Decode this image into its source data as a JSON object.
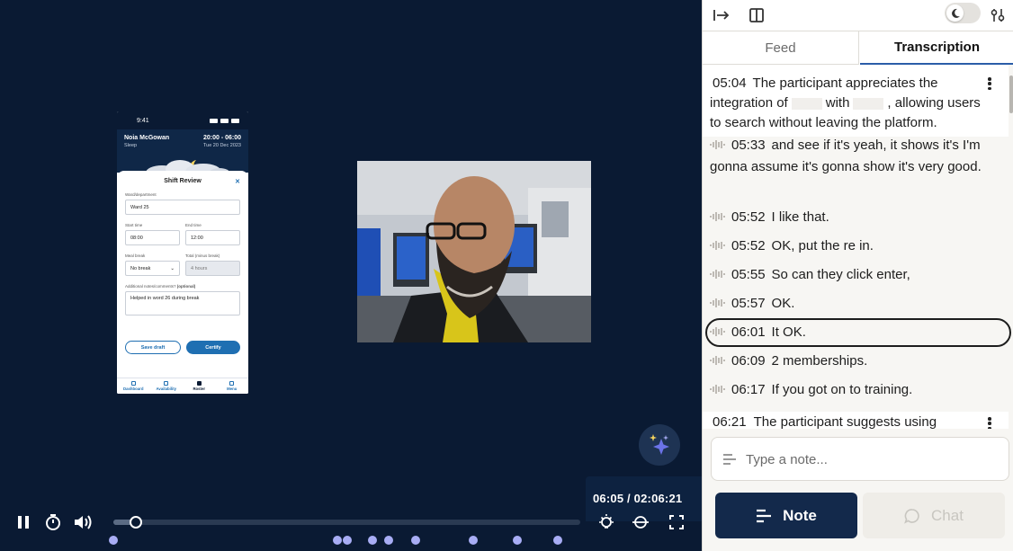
{
  "phone": {
    "status_time": "9:41",
    "user_name": "Noia McGowan",
    "shift_time": "20:00 - 06:00",
    "shift_type": "Sleep",
    "shift_date": "Tue 20 Dec 2023",
    "sheet_title": "Shift Review",
    "ward_label": "Ward/department",
    "ward_value": "Ward 25",
    "start_label": "Start time",
    "start_value": "08:00",
    "end_label": "End time",
    "end_value": "12:00",
    "meal_label": "Meal break",
    "meal_value": "No break",
    "total_label": "Total (minus break)",
    "total_value": "4 hours",
    "notes_label": "Additional notes/comments?",
    "notes_optional": "(optional)",
    "notes_value": "Helped in word 26 during break",
    "save_draft": "Save draft",
    "certify": "Certify",
    "tabs": [
      "Dashboard",
      "Availability",
      "Roster",
      "Menu"
    ]
  },
  "player": {
    "time_display": "06:05 / 02:06:21",
    "progress": 0.048,
    "marker_fractions": [
      0.0,
      0.48,
      0.5,
      0.555,
      0.59,
      0.647,
      0.77,
      0.865,
      0.952
    ]
  },
  "panel": {
    "tabs": {
      "feed": "Feed",
      "transcription": "Transcription"
    },
    "summary": {
      "time": "05:04",
      "text_before": "The participant appreciates the integration of",
      "text_mid": "with",
      "text_after": ", allowing users to search without leaving the platform."
    },
    "utterances": [
      {
        "time": "05:33",
        "text": "and see if it's yeah, it shows it's I'm gonna assume it's gonna show it's very good."
      },
      {
        "time": "05:52",
        "text": "I like that."
      },
      {
        "time": "05:52",
        "text": "OK, put the re in."
      },
      {
        "time": "05:55",
        "text": "So can they click enter,"
      },
      {
        "time": "05:57",
        "text": "OK."
      },
      {
        "time": "06:01",
        "text": "It OK."
      },
      {
        "time": "06:09",
        "text": "2 memberships."
      },
      {
        "time": "06:17",
        "text": "If you got on to training."
      }
    ],
    "insight_peek": {
      "time": "06:21",
      "text": "The participant suggests using"
    },
    "note_placeholder": "Type a note...",
    "note_button": "Note",
    "chat_button": "Chat"
  },
  "colors": {
    "player_bg": "#0a1a33",
    "accent_dark": "#13294b",
    "marker": "#a8adf5",
    "active_tab_underline": "#2b5da8"
  }
}
